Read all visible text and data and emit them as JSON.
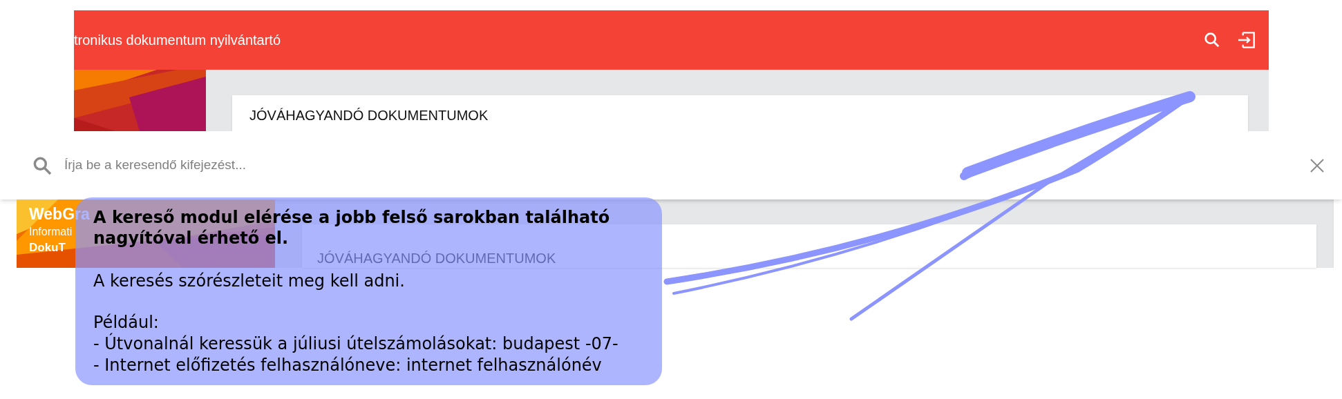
{
  "app_bar": {
    "title": "tronikus dokumentum nyilvántartó"
  },
  "upper_card": {
    "header": "JÓVÁHAGYANDÓ DOKUMENTUMOK"
  },
  "search": {
    "placeholder": "Írja be a keresendő kifejezést..."
  },
  "profile": {
    "company": "WebGra",
    "department": "Informati",
    "user": "DokuT"
  },
  "lower_card": {
    "header": "JÓVÁHAGYANDÓ DOKUMENTUMOK"
  },
  "callout": {
    "title": "A kereső modul elérése a jobb felső sarokban található nagyítóval érhető el.",
    "intro": "A keresés szórészleteit meg kell adni.",
    "example_lines": [
      "Például:",
      "- Útvonalnál keressük a júliusi útelszámolásokat: budapest -07-",
      "- Internet előfizetés felhasználóneve: internet felhasználónév"
    ]
  }
}
